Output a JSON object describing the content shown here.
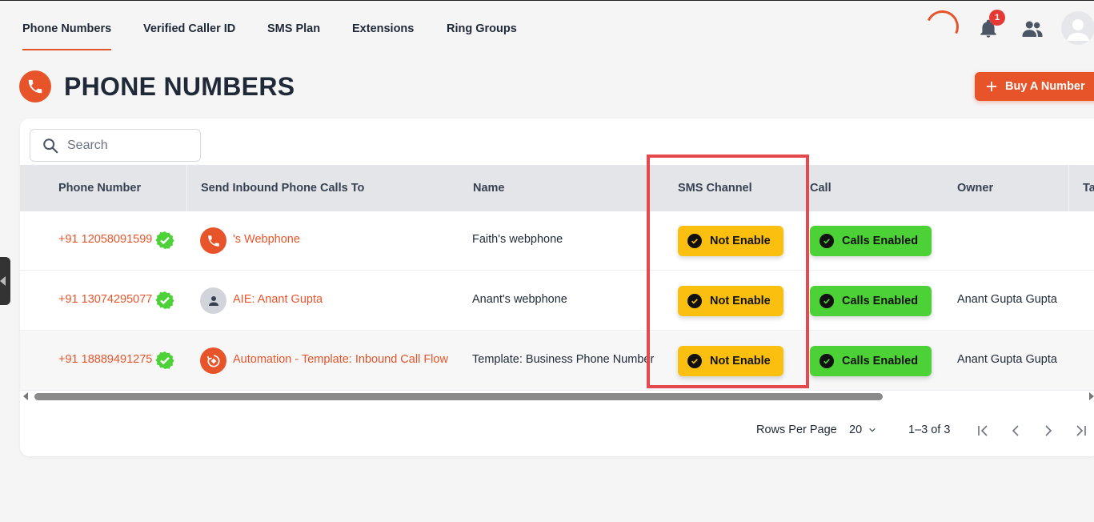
{
  "nav": {
    "tabs": [
      "Phone Numbers",
      "Verified Caller ID",
      "SMS Plan",
      "Extensions",
      "Ring Groups"
    ],
    "active_tab": "Phone Numbers",
    "notification_count": "1"
  },
  "header": {
    "title": "PHONE NUMBERS",
    "buy_button": "Buy A Number"
  },
  "search": {
    "placeholder": "Search"
  },
  "table": {
    "columns": [
      "Phone Number",
      "Send Inbound Phone Calls To",
      "Name",
      "SMS Channel",
      "Call",
      "Owner",
      "Ta"
    ],
    "rows": [
      {
        "phone": "+91 12058091599",
        "route": "'s Webphone",
        "route_icon": "phone-icon",
        "name": "Faith's webphone",
        "sms": "Not Enable",
        "call": "Calls Enabled",
        "owner": ""
      },
      {
        "phone": "+91 13074295077",
        "route": "AIE: Anant Gupta",
        "route_icon": "user-icon",
        "name": "Anant's webphone",
        "sms": "Not Enable",
        "call": "Calls Enabled",
        "owner": "Anant Gupta Gupta"
      },
      {
        "phone": "+91 18889491275",
        "route": "Automation - Template: Inbound Call Flow",
        "route_icon": "automation-icon",
        "name": "Template: Business Phone Number",
        "sms": "Not Enable",
        "call": "Calls Enabled",
        "owner": "Anant Gupta Gupta"
      }
    ]
  },
  "pagination": {
    "rows_per_page_label": "Rows Per Page",
    "rows_per_page_value": "20",
    "range": "1–3 of 3"
  },
  "colors": {
    "accent": "#e8542a",
    "sms_disabled": "#fbbf10",
    "call_enabled": "#4cd137",
    "highlight": "#e5484d"
  }
}
